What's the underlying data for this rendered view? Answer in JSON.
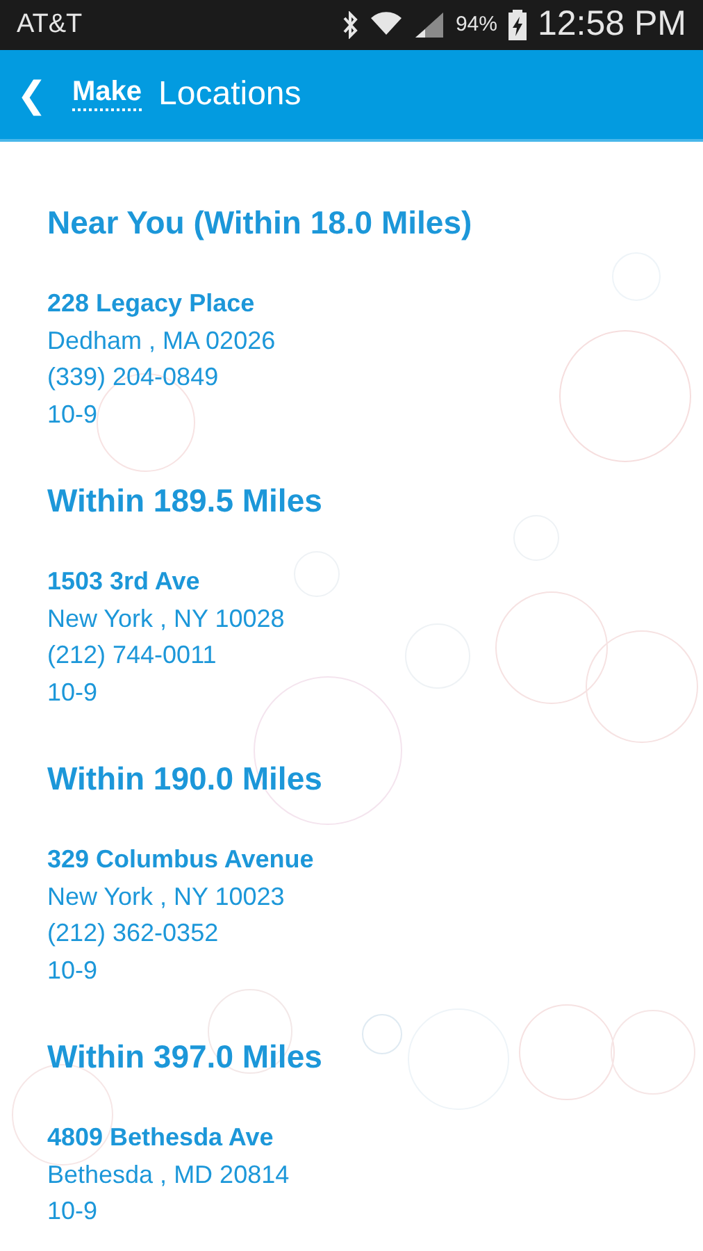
{
  "status_bar": {
    "carrier": "AT&T",
    "battery": "94%",
    "time": "12:58 PM"
  },
  "header": {
    "back": "❮",
    "logo": "Make",
    "title": "Locations"
  },
  "sections": [
    {
      "heading": "Near You (Within 18.0 Miles)",
      "address": "228 Legacy Place",
      "city": "Dedham , MA 02026",
      "phone": "(339) 204-0849",
      "hours": "10-9"
    },
    {
      "heading": "Within 189.5 Miles",
      "address": "1503 3rd Ave",
      "city": "New York , NY 10028",
      "phone": "(212) 744-0011",
      "hours": "10-9"
    },
    {
      "heading": "Within 190.0 Miles",
      "address": "329 Columbus Avenue",
      "city": "New York , NY 10023",
      "phone": "(212) 362-0352",
      "hours": "10-9"
    },
    {
      "heading": "Within 397.0 Miles",
      "address": "4809 Bethesda Ave",
      "city": "Bethesda , MD 20814",
      "hours": "10-9"
    }
  ]
}
